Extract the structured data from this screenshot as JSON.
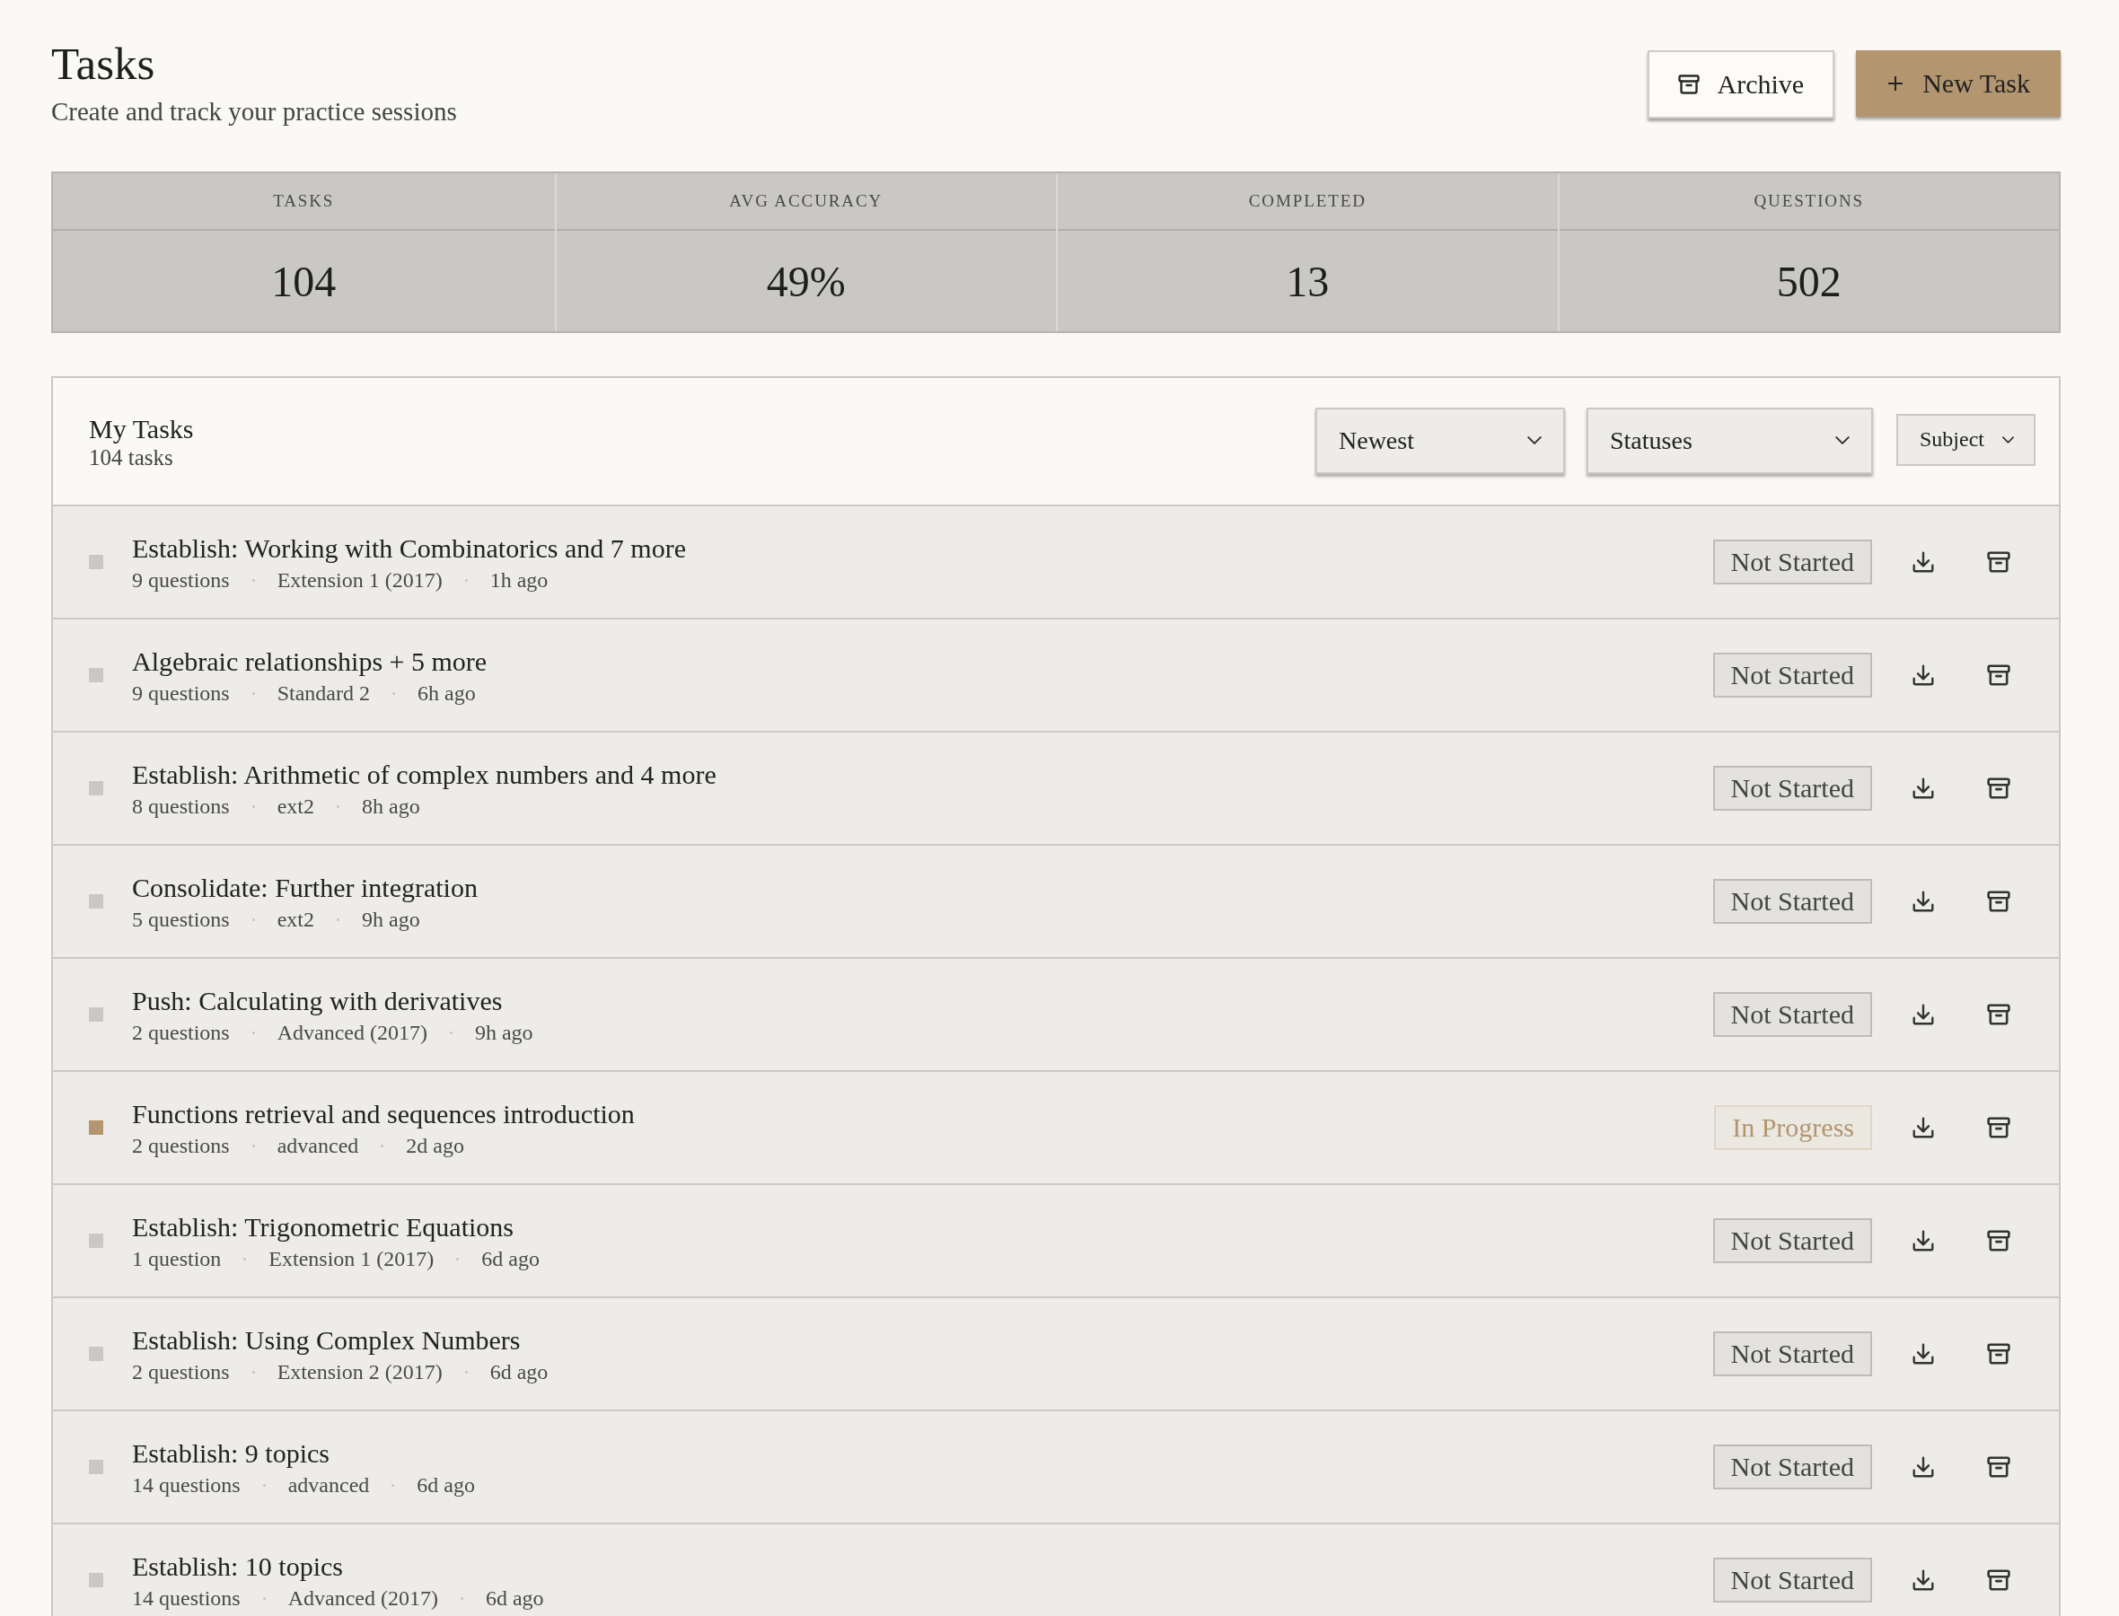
{
  "page": {
    "title": "Tasks",
    "subtitle": "Create and track your practice sessions"
  },
  "header_buttons": [
    {
      "label": "Archive",
      "kind": "secondary"
    },
    {
      "label": "New Task",
      "kind": "primary"
    }
  ],
  "stats": [
    {
      "label": "TASKS",
      "value": "104"
    },
    {
      "label": "AVG ACCURACY",
      "value": "49%"
    },
    {
      "label": "COMPLETED",
      "value": "13"
    },
    {
      "label": "QUESTIONS",
      "value": "502"
    }
  ],
  "task_list": {
    "title": "My Tasks",
    "count": "104 tasks",
    "filters": [
      {
        "label": "Newest",
        "kind": "select"
      },
      {
        "label": "Statuses",
        "kind": "select"
      },
      {
        "label": "Subject",
        "kind": "compact"
      }
    ],
    "tasks": [
      {
        "title": "Establish: Working with Combinatorics and 7 more",
        "meta": [
          "9 questions",
          "Extension 1 (2017)",
          "1h ago"
        ],
        "status": "Not Started",
        "kind": "not_started"
      },
      {
        "title": "Algebraic relationships + 5 more",
        "meta": [
          "9 questions",
          "Standard 2",
          "6h ago"
        ],
        "status": "Not Started",
        "kind": "not_started"
      },
      {
        "title": "Establish: Arithmetic of complex numbers and 4 more",
        "meta": [
          "8 questions",
          "ext2",
          "8h ago"
        ],
        "status": "Not Started",
        "kind": "not_started"
      },
      {
        "title": "Consolidate: Further integration",
        "meta": [
          "5 questions",
          "ext2",
          "9h ago"
        ],
        "status": "Not Started",
        "kind": "not_started"
      },
      {
        "title": "Push: Calculating with derivatives",
        "meta": [
          "2 questions",
          "Advanced (2017)",
          "9h ago"
        ],
        "status": "Not Started",
        "kind": "not_started"
      },
      {
        "title": "Functions retrieval and sequences introduction",
        "meta": [
          "2 questions",
          "advanced",
          "2d ago"
        ],
        "status": "In Progress",
        "kind": "in_progress"
      },
      {
        "title": "Establish: Trigonometric Equations",
        "meta": [
          "1 question",
          "Extension 1 (2017)",
          "6d ago"
        ],
        "status": "Not Started",
        "kind": "not_started"
      },
      {
        "title": "Establish: Using Complex Numbers",
        "meta": [
          "2 questions",
          "Extension 2 (2017)",
          "6d ago"
        ],
        "status": "Not Started",
        "kind": "not_started"
      },
      {
        "title": "Establish: 9 topics",
        "meta": [
          "14 questions",
          "advanced",
          "6d ago"
        ],
        "status": "Not Started",
        "kind": "not_started"
      },
      {
        "title": "Establish: 10 topics",
        "meta": [
          "14 questions",
          "Advanced (2017)",
          "6d ago"
        ],
        "status": "Not Started",
        "kind": "not_started"
      }
    ]
  }
}
